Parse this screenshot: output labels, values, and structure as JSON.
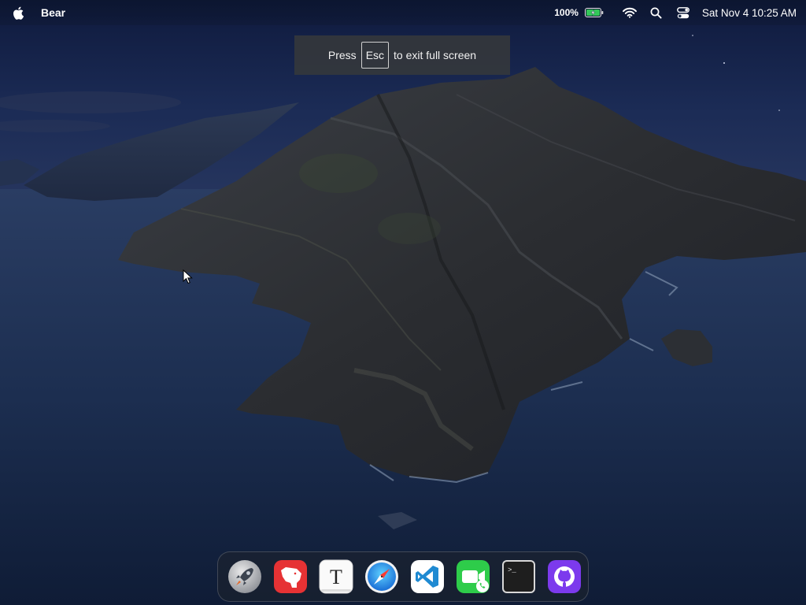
{
  "menubar": {
    "apple_icon": "apple-logo-icon",
    "app_name": "Bear",
    "battery_percent": "100%",
    "battery_level": 1.0,
    "clock": "Sat Nov 4  10:25 AM",
    "icons": [
      "battery-charging-icon",
      "wifi-icon",
      "search-icon",
      "control-center-icon"
    ]
  },
  "toast": {
    "prefix": "Press",
    "key": "Esc",
    "suffix": "to exit full screen"
  },
  "dock": {
    "items": [
      {
        "name": "Launchpad",
        "icon": "rocket-icon"
      },
      {
        "name": "Bear",
        "icon": "bear-icon"
      },
      {
        "name": "Typora",
        "icon": "typora-icon",
        "glyph": "T"
      },
      {
        "name": "Safari",
        "icon": "safari-compass-icon"
      },
      {
        "name": "Visual Studio Code",
        "icon": "vscode-icon"
      },
      {
        "name": "FaceTime",
        "icon": "facetime-icon"
      },
      {
        "name": "Terminal",
        "icon": "terminal-icon",
        "glyph": ">_"
      },
      {
        "name": "GitHub Desktop",
        "icon": "github-icon"
      }
    ]
  },
  "colors": {
    "sky_top": "#141f44",
    "sea": "#1b2d4d",
    "bear_red": "#e63234",
    "vscode_blue": "#1f8ad2",
    "facetime_green": "#2ecc4a",
    "github_purple": "#7c3aed"
  }
}
